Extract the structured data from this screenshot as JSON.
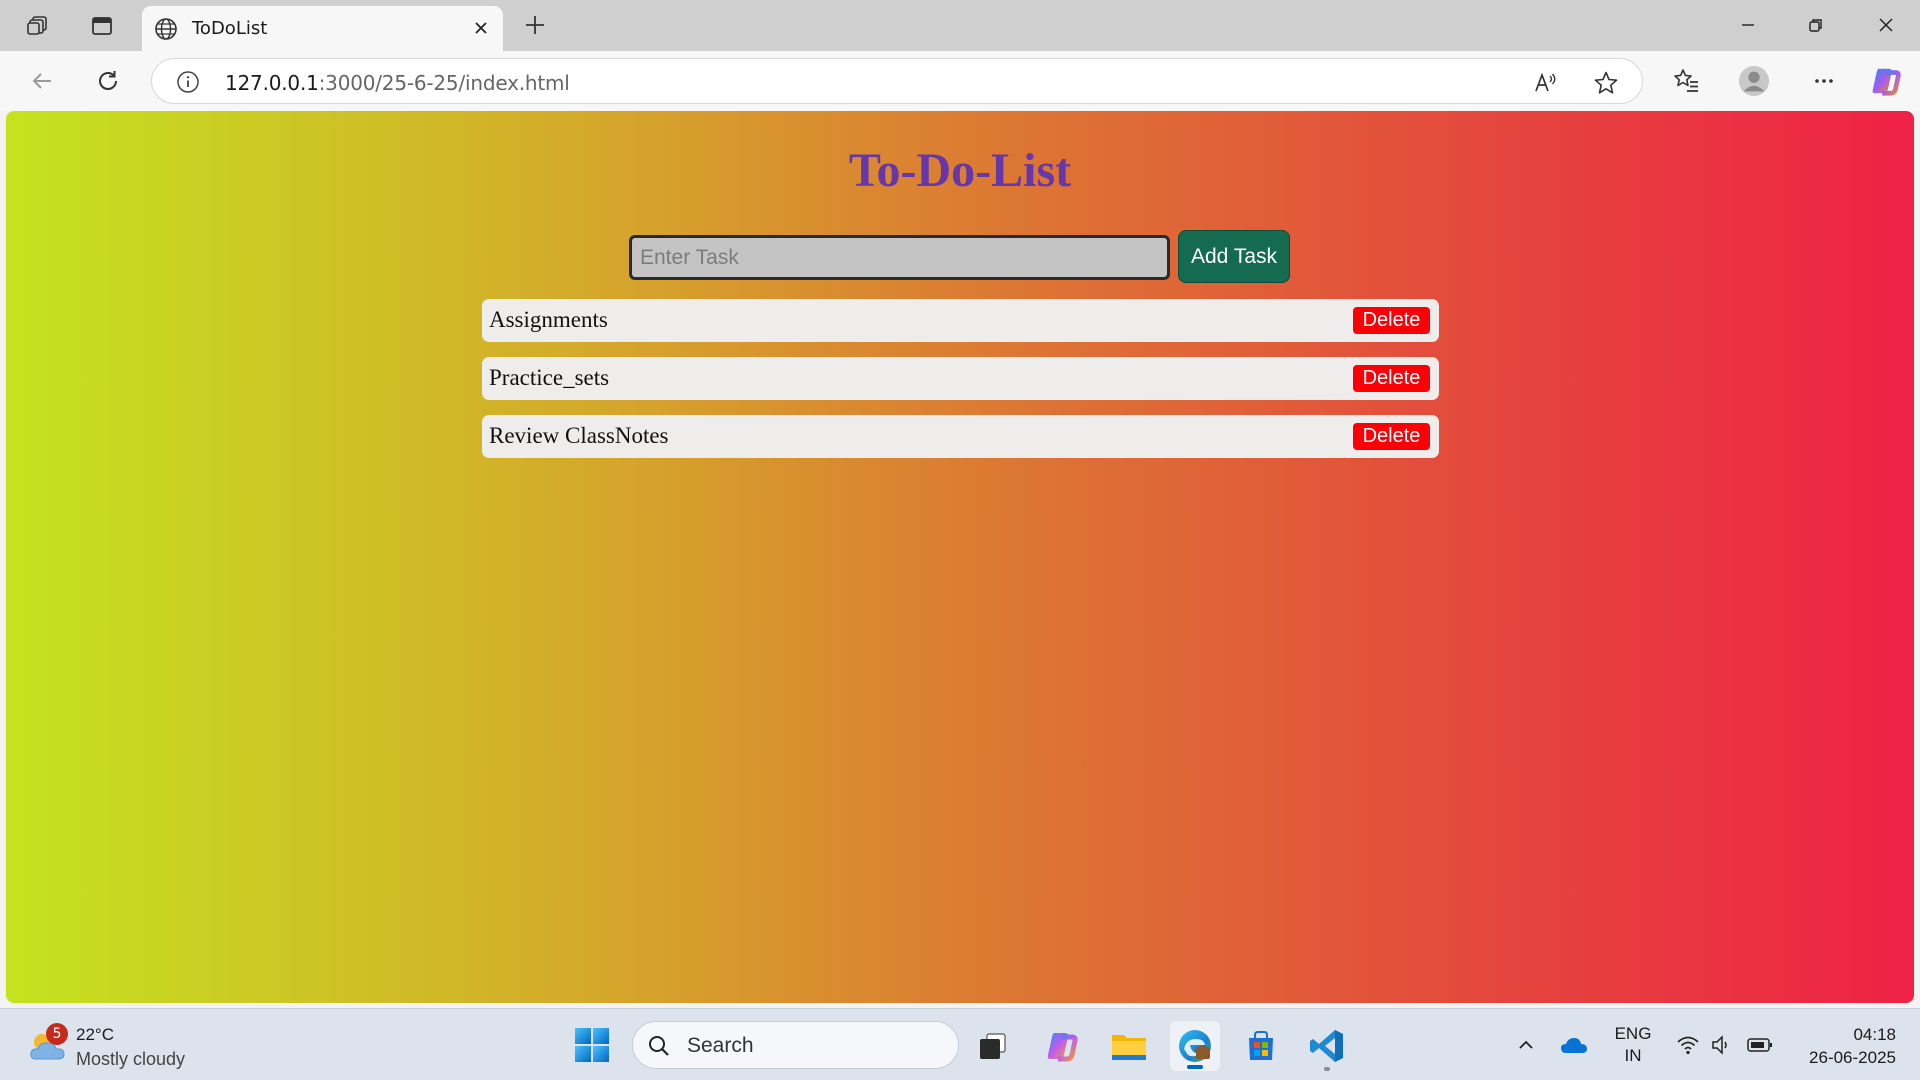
{
  "browser": {
    "tab_title": "ToDoList",
    "url_host": "127.0.0.1",
    "url_path": ":3000/25-6-25/index.html"
  },
  "page": {
    "title": "To-Do-List",
    "input_placeholder": "Enter Task",
    "input_value": "",
    "add_button_label": "Add Task",
    "delete_label": "Delete",
    "tasks": [
      {
        "text": "Assignments"
      },
      {
        "text": "Practice_sets"
      },
      {
        "text": "Review ClassNotes"
      }
    ],
    "colors": {
      "title": "#6637a8",
      "add_button": "#146b50",
      "delete_button": "#fb0006",
      "gradient": [
        "#c4e31f",
        "#d4aa2a",
        "#dd7234",
        "#e5433e",
        "#ef2145"
      ]
    }
  },
  "taskbar": {
    "weather_badge": "5",
    "weather_temp": "22°C",
    "weather_desc": "Mostly cloudy",
    "search_label": "Search",
    "lang_primary": "ENG",
    "lang_secondary": "IN",
    "time": "04:18",
    "date": "26-06-2025"
  }
}
